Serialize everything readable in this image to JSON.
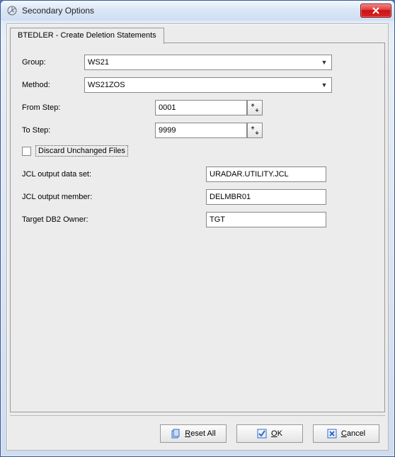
{
  "window": {
    "title": "Secondary Options"
  },
  "tab": {
    "label": "BTEDLER - Create Deletion Statements"
  },
  "form": {
    "group": {
      "label": "Group:",
      "value": "WS21"
    },
    "method": {
      "label": "Method:",
      "value": "WS21ZOS"
    },
    "from_step": {
      "label": "From Step:",
      "value": "0001"
    },
    "to_step": {
      "label": "To Step:",
      "value": "9999"
    },
    "discard": {
      "label": "Discard Unchanged Files",
      "checked": false
    },
    "jcl_dataset": {
      "label": "JCL output data set:",
      "value": "URADAR.UTILITY.JCL"
    },
    "jcl_member": {
      "label": "JCL output member:",
      "value": "DELMBR01"
    },
    "target_owner": {
      "label": "Target DB2 Owner:",
      "value": "TGT"
    }
  },
  "buttons": {
    "reset": "Reset All",
    "ok": "OK",
    "cancel": "Cancel"
  }
}
